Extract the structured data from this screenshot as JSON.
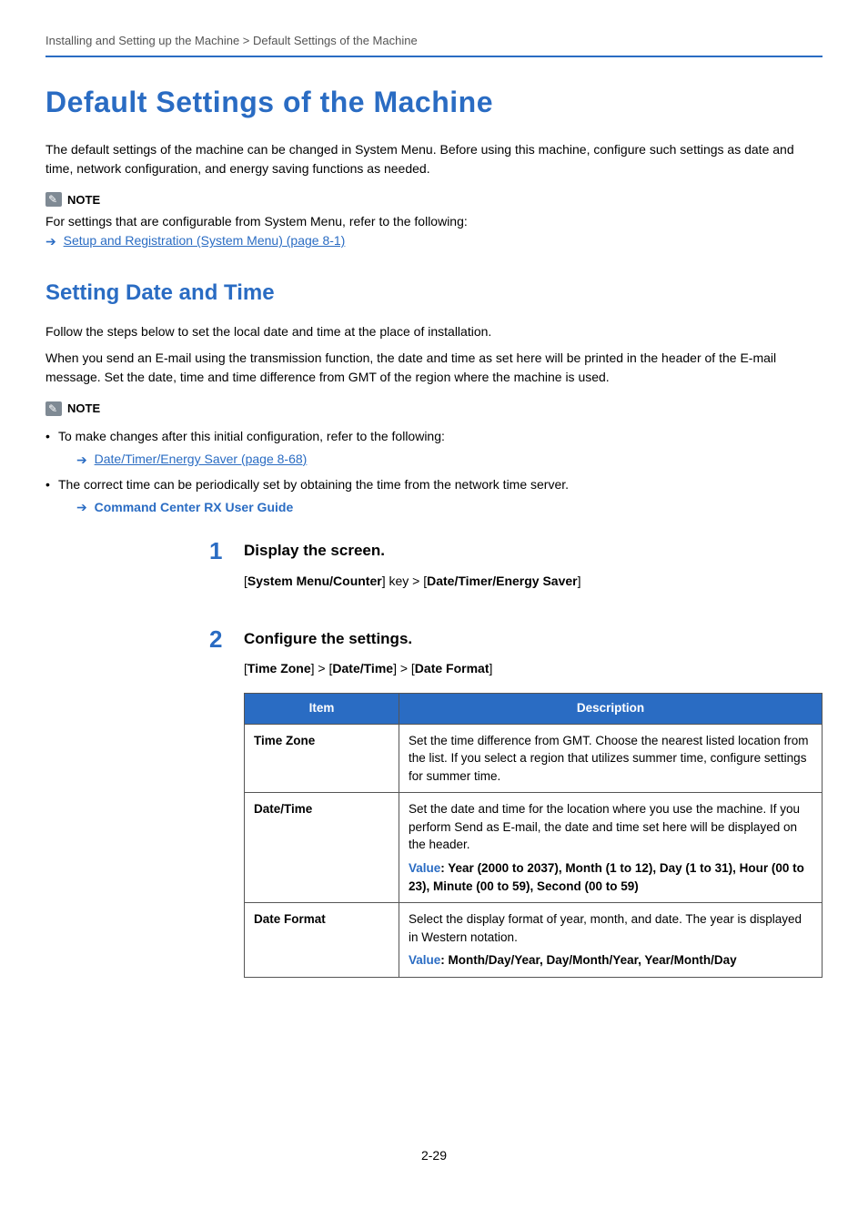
{
  "breadcrumb": "Installing and Setting up the Machine > Default Settings of the Machine",
  "h1": "Default Settings of the Machine",
  "intro": "The default settings of the machine can be changed in System Menu. Before using this machine, configure such settings as date and time, network configuration, and energy saving functions as needed.",
  "note1": {
    "label": "NOTE",
    "text": "For settings that are configurable from System Menu, refer to the following:",
    "link": "Setup and Registration (System Menu) (page 8-1)"
  },
  "h2": "Setting Date and Time",
  "h2_p1": "Follow the steps below to set the local date and time at the place of installation.",
  "h2_p2": "When you send an E-mail using the transmission function, the date and time as set here will be printed in the header of the E-mail message. Set the date, time and time difference from GMT of the region where the machine is used.",
  "note2": {
    "label": "NOTE",
    "b1": "To make changes after this initial configuration, refer to the following:",
    "b1_link": "Date/Timer/Energy Saver (page 8-68)",
    "b2": "The correct time can be periodically set by obtaining the time from the network time server.",
    "b2_link": "Command Center RX User Guide"
  },
  "step1": {
    "num": "1",
    "title": "Display the screen.",
    "path_pre": "[",
    "path_b1": "System Menu/Counter",
    "path_mid1": "] key > [",
    "path_b2": "Date/Timer/Energy Saver",
    "path_post": "]"
  },
  "step2": {
    "num": "2",
    "title": "Configure the settings.",
    "path_pre": "[",
    "path_b1": "Time Zone",
    "path_mid1": "] > [",
    "path_b2": "Date/Time",
    "path_mid2": "] > [",
    "path_b3": "Date Format",
    "path_post": "]"
  },
  "table": {
    "h_item": "Item",
    "h_desc": "Description",
    "rows": [
      {
        "item": "Time Zone",
        "desc": "Set the time difference from GMT. Choose the nearest listed location from the list. If you select a region that utilizes summer time, configure settings for summer time."
      },
      {
        "item": "Date/Time",
        "desc": "Set the date and time for the location where you use the machine. If you perform Send as E-mail, the date and time set here will be displayed on the header.",
        "value_label": "Value",
        "value_text": ": Year (2000 to 2037), Month (1 to 12), Day (1 to 31), Hour (00 to 23), Minute (00 to 59), Second (00 to 59)"
      },
      {
        "item": "Date Format",
        "desc": "Select the display format of year, month, and date. The year is displayed in Western notation.",
        "value_label": "Value",
        "value_text": ": Month/Day/Year, Day/Month/Year, Year/Month/Day"
      }
    ]
  },
  "page_number": "2-29"
}
